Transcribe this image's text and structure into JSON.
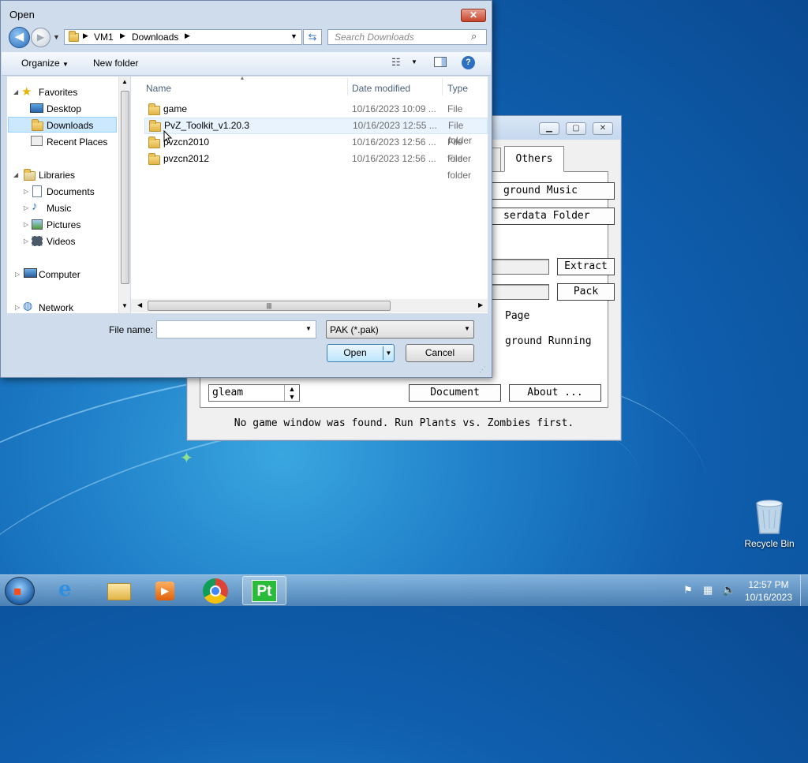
{
  "dialog": {
    "title": "Open",
    "close_glyph": "✕",
    "breadcrumb": [
      "VM1",
      "Downloads"
    ],
    "search_placeholder": "Search Downloads",
    "organize_label": "Organize",
    "new_folder_label": "New folder",
    "nav": {
      "favorites": "Favorites",
      "desktop": "Desktop",
      "downloads": "Downloads",
      "recent_places": "Recent Places",
      "libraries": "Libraries",
      "documents": "Documents",
      "music": "Music",
      "pictures": "Pictures",
      "videos": "Videos",
      "computer": "Computer",
      "network": "Network"
    },
    "columns": {
      "name": "Name",
      "date": "Date modified",
      "type": "Type"
    },
    "files": [
      {
        "name": "game",
        "date": "10/16/2023 10:09 ...",
        "type": "File folder"
      },
      {
        "name": "PvZ_Toolkit_v1.20.3",
        "date": "10/16/2023 12:55 ...",
        "type": "File folder"
      },
      {
        "name": "pvzcn2010",
        "date": "10/16/2023 12:56 ...",
        "type": "File folder"
      },
      {
        "name": "pvzcn2012",
        "date": "10/16/2023 12:56 ...",
        "type": "File folder"
      }
    ],
    "file_name_label": "File name:",
    "file_name_value": "",
    "file_type": "PAK (*.pak)",
    "open_label": "Open",
    "cancel_label": "Cancel"
  },
  "toolkit": {
    "tab_others": "Others",
    "btn_background_music": "ground Music",
    "btn_userdata_folder": "serdata Folder",
    "btn_extract": "Extract",
    "btn_pack": "Pack",
    "text_page": "Page",
    "text_background_running": "ground Running",
    "select_value": "gleam",
    "btn_document": "Document",
    "btn_about": "About ...",
    "status": "No game window was found. Run Plants vs. Zombies first."
  },
  "desktop": {
    "recycle_bin_label": "Recycle Bin"
  },
  "taskbar": {
    "time": "12:57 PM",
    "date": "10/16/2023",
    "pt_label": "Pt"
  },
  "colors": {
    "accent": "#1f7fc8",
    "selection": "#cce8ff",
    "taskbar": "#6d9cc8"
  }
}
